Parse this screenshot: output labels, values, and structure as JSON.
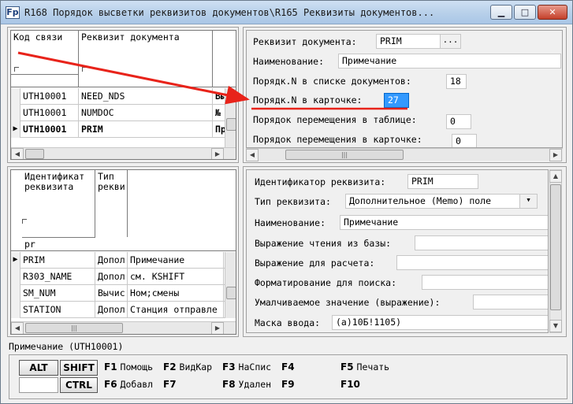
{
  "window": {
    "title": "R168 Порядок высветки реквизитов документов\\R165 Реквизиты документов...",
    "icon_label": "Fp",
    "controls": [
      "minimize-icon",
      "maximize-icon",
      "close-icon"
    ]
  },
  "top_grid": {
    "headers": [
      "Код связи",
      "Реквизит документа"
    ],
    "rows": [
      {
        "code": "UTH10001",
        "field": "NEED_NDS",
        "extra": "Вы",
        "current": false
      },
      {
        "code": "UTH10001",
        "field": "NUMDOC",
        "extra": "№",
        "current": false
      },
      {
        "code": "UTH10001",
        "field": "PRIM",
        "extra": "Пр",
        "current": true
      }
    ]
  },
  "top_form": {
    "doc_field_label": "Реквизит документа:",
    "doc_field_value": "PRIM",
    "doc_field_button": "...",
    "name_label": "Наименование:",
    "name_value": "Примечание",
    "order_list_label": "Порядк.N в списке документов:",
    "order_list_value": "18",
    "order_card_label": "Порядк.N в карточке:",
    "order_card_value": "27",
    "move_table_label": "Порядок перемещения в таблице:",
    "move_table_value": "0",
    "move_card_label": "Порядок перемещения в карточке:",
    "move_card_value": "0"
  },
  "bottom_grid": {
    "headers": [
      "Идентификат реквизита",
      "Тип рекви"
    ],
    "filter_value": "pr",
    "rows": [
      {
        "id": "PRIM",
        "type": "Допол",
        "name": "Примечание",
        "current": true
      },
      {
        "id": "R303_NAME",
        "type": "Допол",
        "name": "см. KSHIFT",
        "current": false
      },
      {
        "id": "SM_NUM",
        "type": "Вычис",
        "name": "Ном;смены",
        "current": false
      },
      {
        "id": "STATION",
        "type": "Допол",
        "name": "Станция отправле",
        "current": false
      }
    ]
  },
  "bottom_form": {
    "id_label": "Идентификатор реквизита:",
    "id_value": "PRIM",
    "type_label": "Тип реквизита:",
    "type_value": "Дополнительное (Memo) поле",
    "name_label": "Наименование:",
    "name_value": "Примечание",
    "read_expr_label": "Выражение чтения из базы:",
    "calc_expr_label": "Выражение для расчета:",
    "search_format_label": "Форматирование для поиска:",
    "default_label": "Умалчиваемое значение (выражение):",
    "input_mask_label": "Маска ввода:",
    "input_mask_value": "(a)10Б!1105)"
  },
  "status": {
    "text": "Примечание (UTH10001)"
  },
  "fkeys": {
    "alt": "ALT",
    "shift": "SHIFT",
    "ctrl": "CTRL",
    "row1": [
      {
        "key": "F1",
        "label": "Помощь"
      },
      {
        "key": "F2",
        "label": "ВидКар"
      },
      {
        "key": "F3",
        "label": "НаСпис"
      },
      {
        "key": "F4",
        "label": ""
      },
      {
        "key": "F5",
        "label": "Печать"
      }
    ],
    "row2": [
      {
        "key": "F6",
        "label": "Добавл"
      },
      {
        "key": "F7",
        "label": ""
      },
      {
        "key": "F8",
        "label": "Удален"
      },
      {
        "key": "F9",
        "label": ""
      },
      {
        "key": "F10",
        "label": ""
      }
    ]
  },
  "annotation": {
    "color": "#e8231a"
  }
}
